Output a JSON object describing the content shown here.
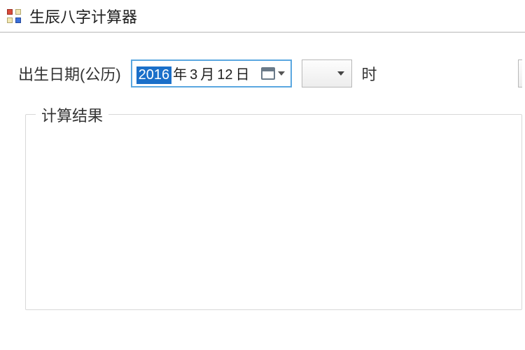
{
  "window": {
    "title": "生辰八字计算器"
  },
  "form": {
    "birth_date_label": "出生日期(公历)",
    "date_picker": {
      "year": "2016",
      "year_suffix": "年",
      "month": "3",
      "month_suffix": "月",
      "day": "12",
      "day_suffix": "日"
    },
    "hour_combo": {
      "selected": ""
    },
    "hour_label": "时"
  },
  "result": {
    "group_title": "计算结果"
  }
}
